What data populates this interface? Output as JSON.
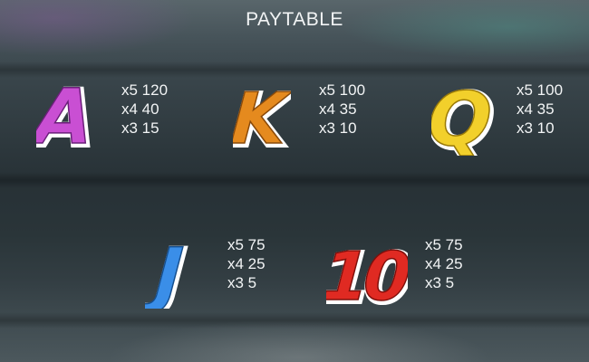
{
  "title": "PAYTABLE",
  "symbols": [
    {
      "name": "A",
      "color": "#c94fd3",
      "pays": [
        "x5 120",
        "x4 40",
        "x3 15"
      ]
    },
    {
      "name": "K",
      "color": "#e58a1e",
      "pays": [
        "x5 100",
        "x4 35",
        "x3 10"
      ]
    },
    {
      "name": "Q",
      "color": "#f2d02b",
      "pays": [
        "x5 100",
        "x4 35",
        "x3 10"
      ]
    },
    {
      "name": "J",
      "color": "#3a8ee8",
      "pays": [
        "x5 75",
        "x4 25",
        "x3 5"
      ]
    },
    {
      "name": "10",
      "color": "#e02a22",
      "pays": [
        "x5 75",
        "x4 25",
        "x3 5"
      ]
    }
  ]
}
